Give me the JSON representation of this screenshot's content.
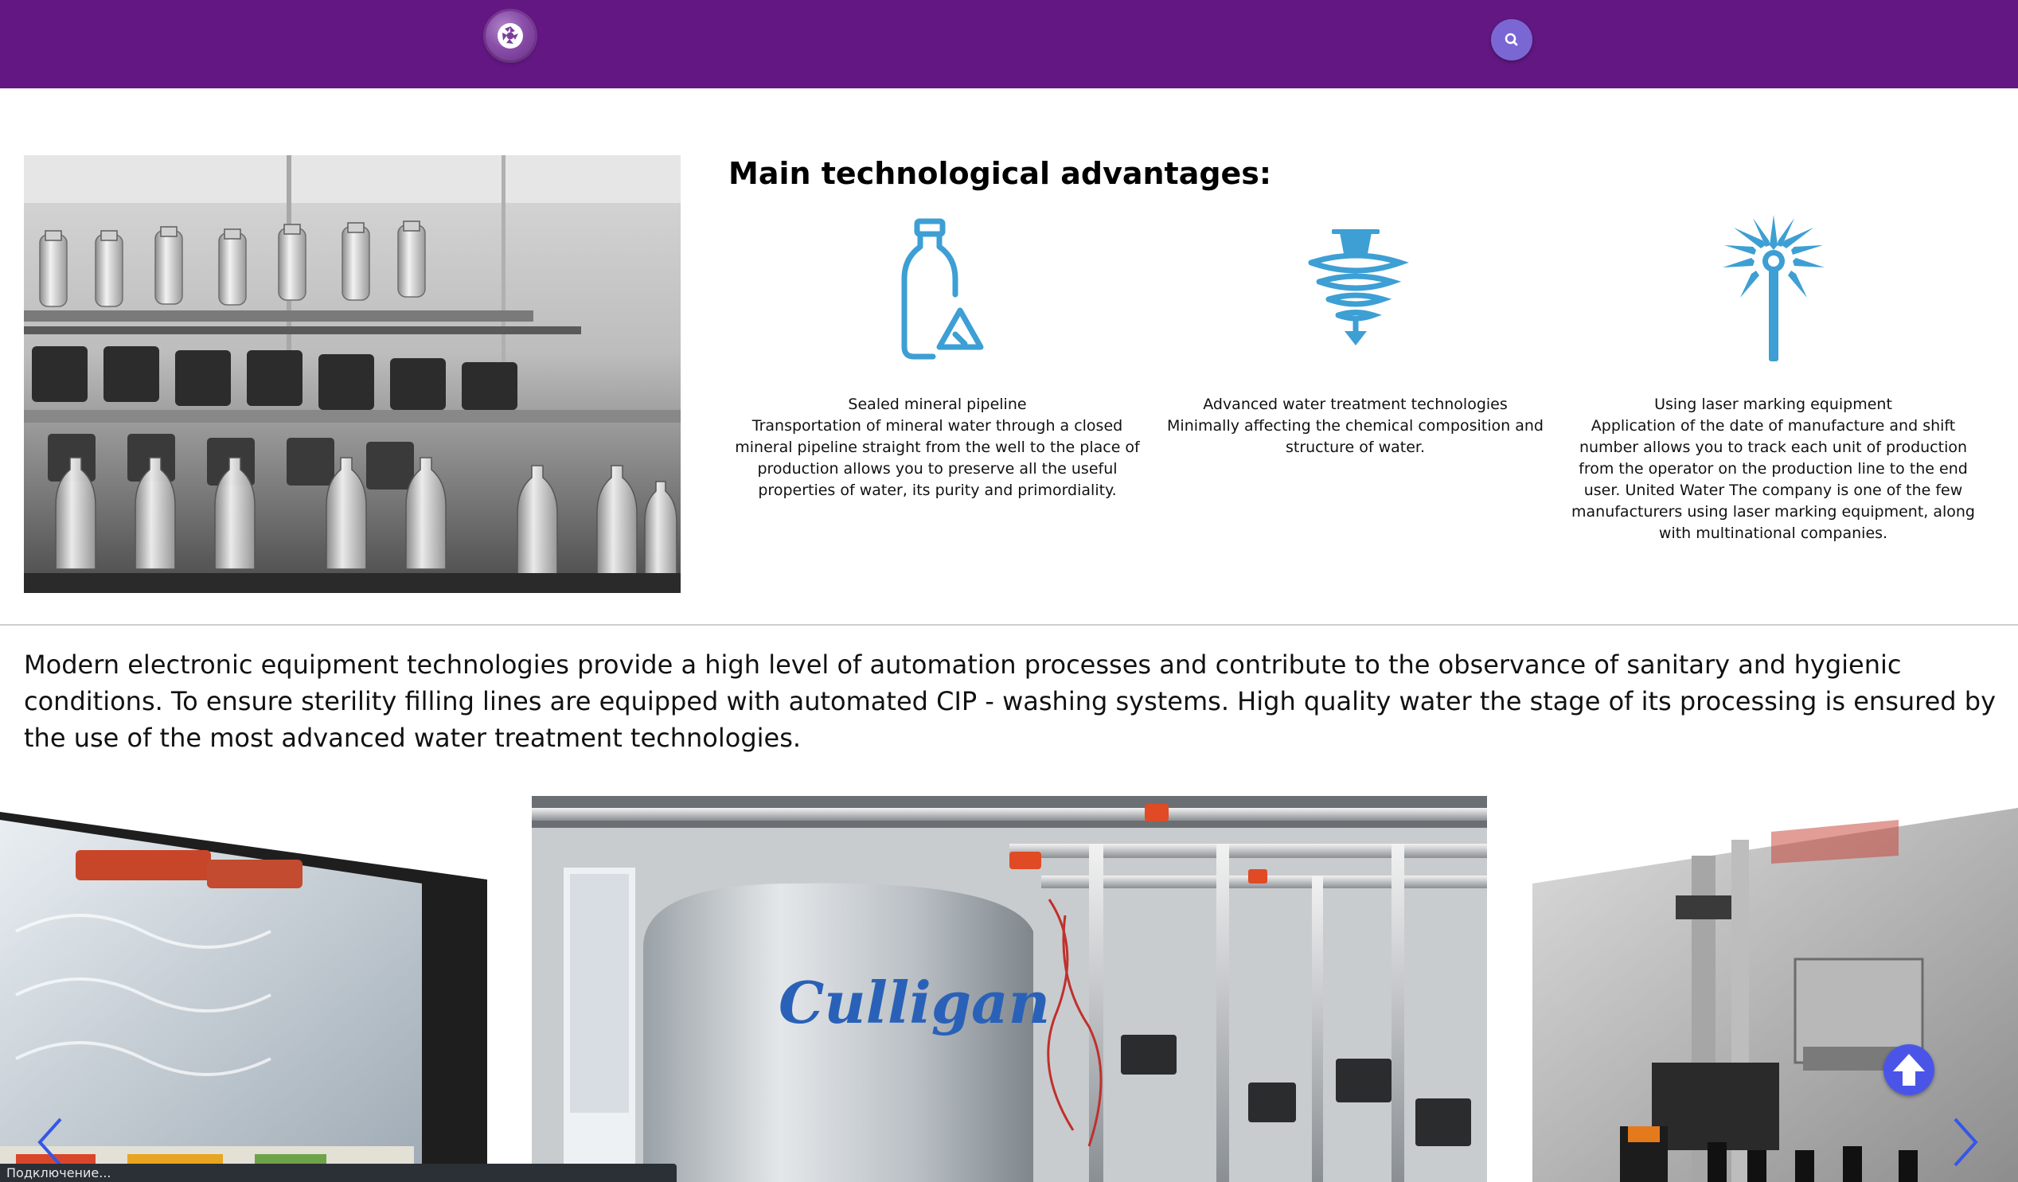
{
  "header": {
    "logo_icon": "camera-aperture-icon",
    "search_icon": "search-icon",
    "colors": {
      "background": "#621782",
      "search_button": "#7a67d3"
    }
  },
  "advantages": {
    "title": "Main technological advantages:",
    "icon_color": "#3d9fd4",
    "items": [
      {
        "icon": "bottle-recycle-icon",
        "heading": "Sealed mineral pipeline",
        "body": "Transportation of mineral water through a closed mineral pipeline straight from the well to the place of production allows you to preserve all the useful properties of water, its purity and primordiality."
      },
      {
        "icon": "water-vortex-icon",
        "heading": "Advanced water treatment technologies",
        "body": "Minimally affecting the chemical composition and structure of water."
      },
      {
        "icon": "laser-burst-icon",
        "heading": "Using laser marking equipment",
        "body": "Application of the date of manufacture and shift number allows you to track each unit of production from the operator on the production line to the end user. United Water The company is one of the few manufacturers using laser marking equipment, along with multinational companies."
      }
    ]
  },
  "lead_text": "Modern electronic equipment technologies provide a high level of automation processes and contribute to the observance of sanitary and hygienic conditions. To ensure sterility filling lines are equipped with automated CIP - washing systems. High quality water the stage of its processing is ensured by the use of the most advanced water treatment technologies.",
  "carousel": {
    "center_tank_label": "Culligan",
    "prev_icon": "chevron-left-icon",
    "next_icon": "chevron-right-icon"
  },
  "scroll_top_icon": "arrow-up-circle-icon",
  "status_text": "Подключение..."
}
